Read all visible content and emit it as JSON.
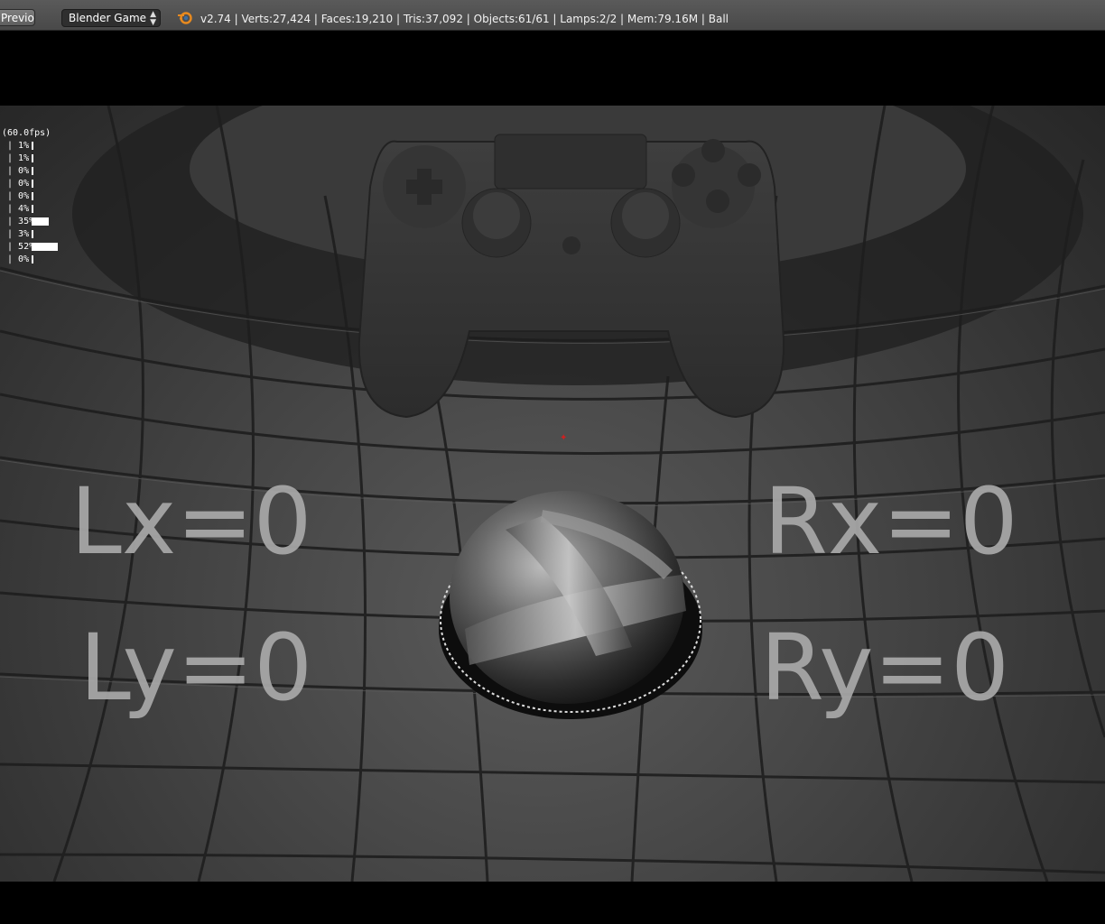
{
  "header": {
    "previous_label": "Previous",
    "engine_label": "Blender Game",
    "stats": "v2.74 | Verts:27,424 | Faces:19,210 | Tris:37,092 | Objects:61/61 | Lamps:2/2 | Mem:79.16M | Ball"
  },
  "profiler": {
    "fps": "(60.0fps)",
    "rows": [
      {
        "value": "1%",
        "level": 0.01
      },
      {
        "value": "1%",
        "level": 0.01
      },
      {
        "value": "0%",
        "level": 0.0
      },
      {
        "value": "0%",
        "level": 0.0
      },
      {
        "value": "0%",
        "level": 0.0
      },
      {
        "value": "4%",
        "level": 0.04
      },
      {
        "value": "35%",
        "level": 0.35
      },
      {
        "value": "3%",
        "level": 0.03
      },
      {
        "value": "52%",
        "level": 0.52
      },
      {
        "value": "0%",
        "level": 0.0
      }
    ]
  },
  "axes": {
    "lx": "Lx=0",
    "ly": "Ly=0",
    "rx": "Rx=0",
    "ry": "Ry=0"
  },
  "icons": {
    "blender_logo": "blender-logo-icon",
    "engine_arrows": "updown-arrows-icon"
  },
  "colors": {
    "header_bg": "#4f4f4f",
    "axis_text": "#a9a9a9",
    "crosshair": "#d02020"
  }
}
